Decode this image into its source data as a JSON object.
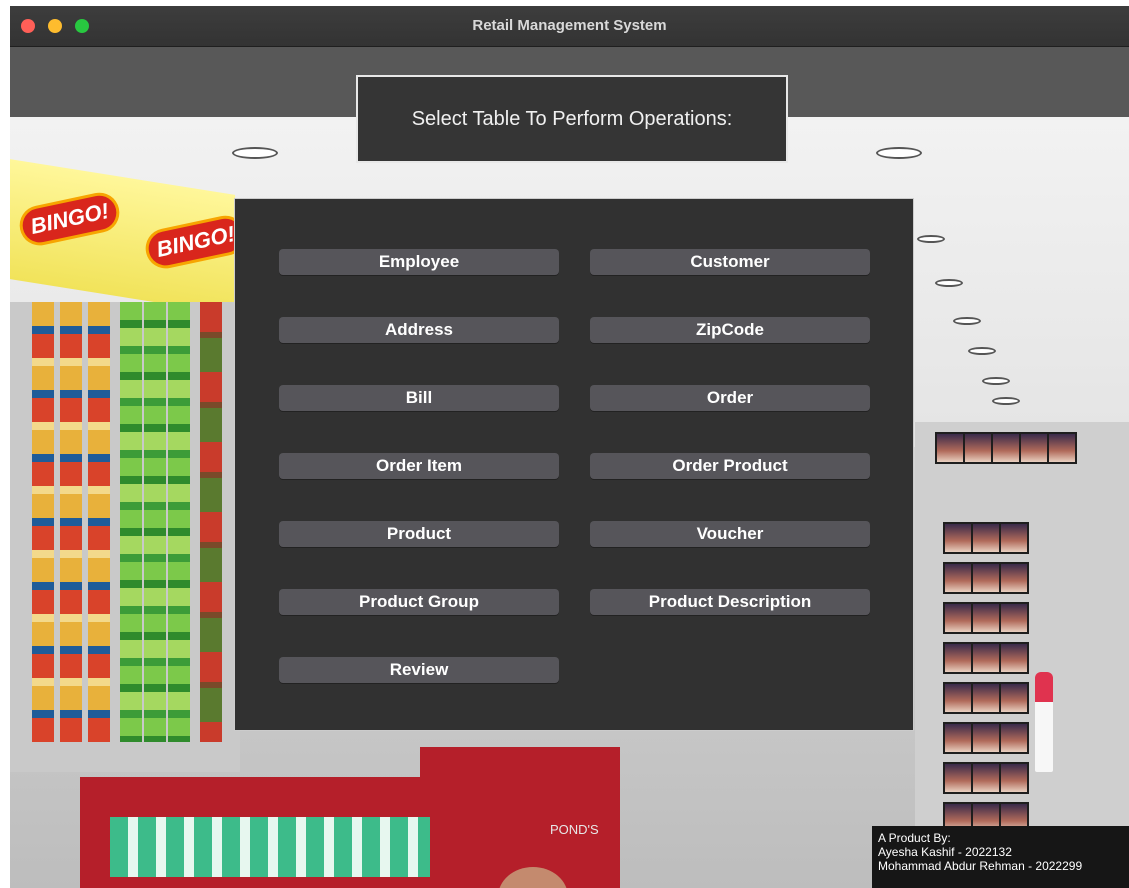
{
  "window": {
    "title": "Retail Management System"
  },
  "header": {
    "text": "Select Table To Perform Operations:"
  },
  "tables": [
    "Employee",
    "Customer",
    "Address",
    "ZipCode",
    "Bill",
    "Order",
    "Order Item",
    "Order Product",
    "Product",
    "Voucher",
    "Product Group",
    "Product Description",
    "Review"
  ],
  "background": {
    "signs": [
      "BINGO!",
      "BINGO!"
    ],
    "pack_text": "POND'S"
  },
  "credits": {
    "heading": "A Product By:",
    "authors": [
      "Ayesha Kashif - 2022132",
      "Mohammad Abdur Rehman - 2022299"
    ]
  }
}
